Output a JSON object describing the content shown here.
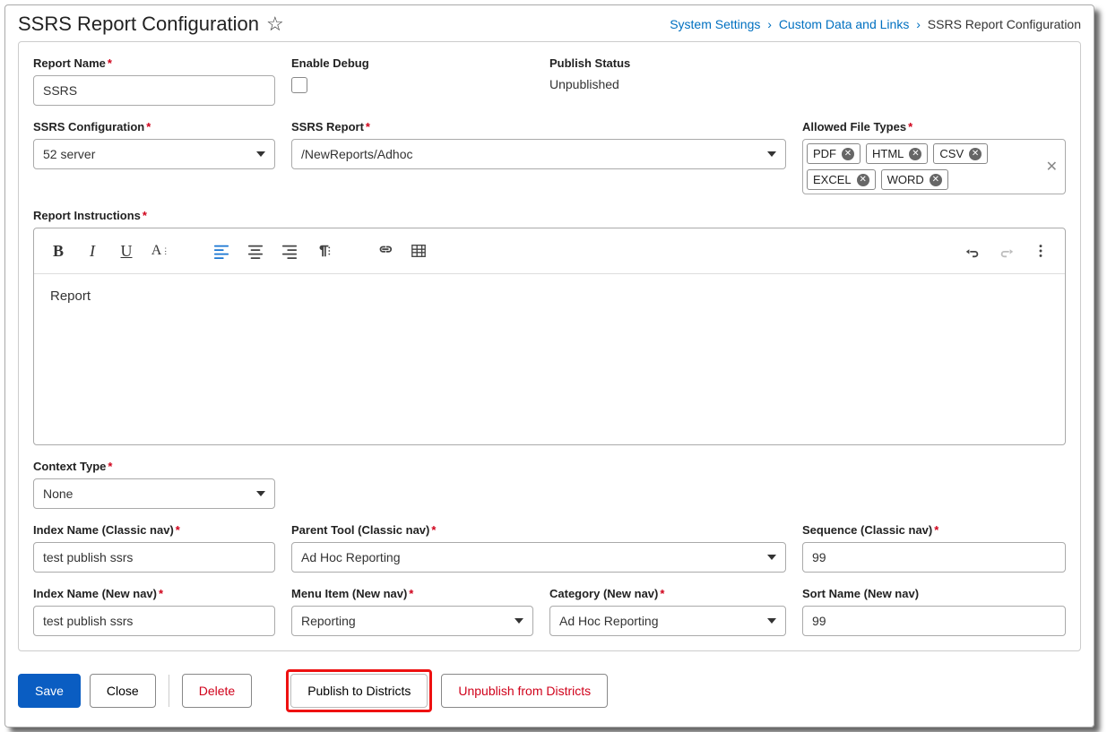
{
  "header": {
    "title": "SSRS Report Configuration",
    "breadcrumbs": [
      {
        "label": "System Settings",
        "link": true
      },
      {
        "label": "Custom Data and Links",
        "link": true
      },
      {
        "label": "SSRS Report Configuration",
        "link": false
      }
    ]
  },
  "fields": {
    "reportName": {
      "label": "Report Name",
      "required": true,
      "value": "SSRS"
    },
    "enableDebug": {
      "label": "Enable Debug",
      "checked": false
    },
    "publishStatus": {
      "label": "Publish Status",
      "value": "Unpublished"
    },
    "ssrsConfig": {
      "label": "SSRS Configuration",
      "required": true,
      "value": "52 server"
    },
    "ssrsReport": {
      "label": "SSRS Report",
      "required": true,
      "value": "/NewReports/Adhoc"
    },
    "allowedTypes": {
      "label": "Allowed File Types",
      "required": true,
      "tags": [
        "PDF",
        "HTML",
        "CSV",
        "EXCEL",
        "WORD"
      ]
    },
    "instructions": {
      "label": "Report Instructions",
      "required": true,
      "content": "Report"
    },
    "contextType": {
      "label": "Context Type",
      "required": true,
      "value": "None"
    },
    "indexClassic": {
      "label": "Index Name (Classic nav)",
      "required": true,
      "value": "test publish ssrs"
    },
    "parentTool": {
      "label": "Parent Tool (Classic nav)",
      "required": true,
      "value": "Ad Hoc Reporting"
    },
    "seqClassic": {
      "label": "Sequence (Classic nav)",
      "required": true,
      "value": "99"
    },
    "indexNew": {
      "label": "Index Name (New nav)",
      "required": true,
      "value": "test publish ssrs"
    },
    "menuItem": {
      "label": "Menu Item (New nav)",
      "required": true,
      "value": "Reporting"
    },
    "category": {
      "label": "Category (New nav)",
      "required": true,
      "value": "Ad Hoc Reporting"
    },
    "sortName": {
      "label": "Sort Name (New nav)",
      "required": false,
      "value": "99"
    }
  },
  "footer": {
    "save": "Save",
    "close": "Close",
    "delete": "Delete",
    "publish": "Publish to Districts",
    "unpublish": "Unpublish from Districts"
  }
}
